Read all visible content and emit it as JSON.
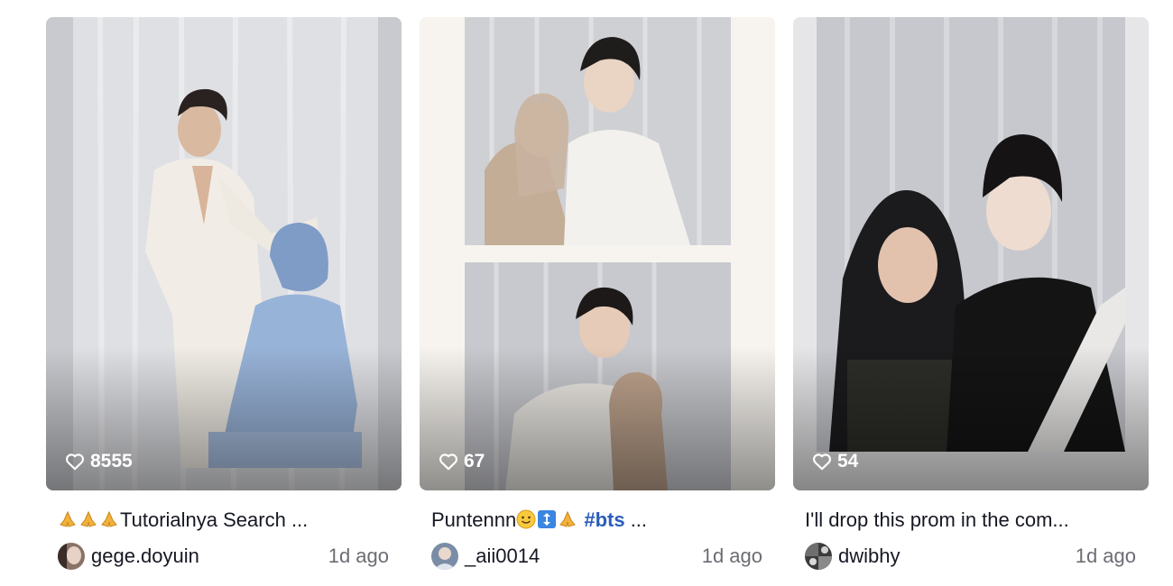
{
  "videos": [
    {
      "likes": "8555",
      "caption_text": "Tutorialnya Search ...",
      "caption_emojis": [
        "folded-hands",
        "folded-hands",
        "folded-hands"
      ],
      "username": "gege.doyuin",
      "time": "1d ago"
    },
    {
      "likes": "67",
      "caption_text": "Puntennn",
      "caption_emojis": [
        "smiling-face",
        "up-down-arrow",
        "folded-hands"
      ],
      "caption_tag": "#bts",
      "caption_suffix": " ...",
      "username": "_aii0014",
      "time": "1d ago"
    },
    {
      "likes": "54",
      "caption_text": "I'll drop this prom in the com...",
      "username": "dwibhy",
      "time": "1d ago"
    }
  ],
  "colors": {
    "text": "#161823",
    "muted": "#6c6d74",
    "hashtag": "#2b5db9"
  }
}
